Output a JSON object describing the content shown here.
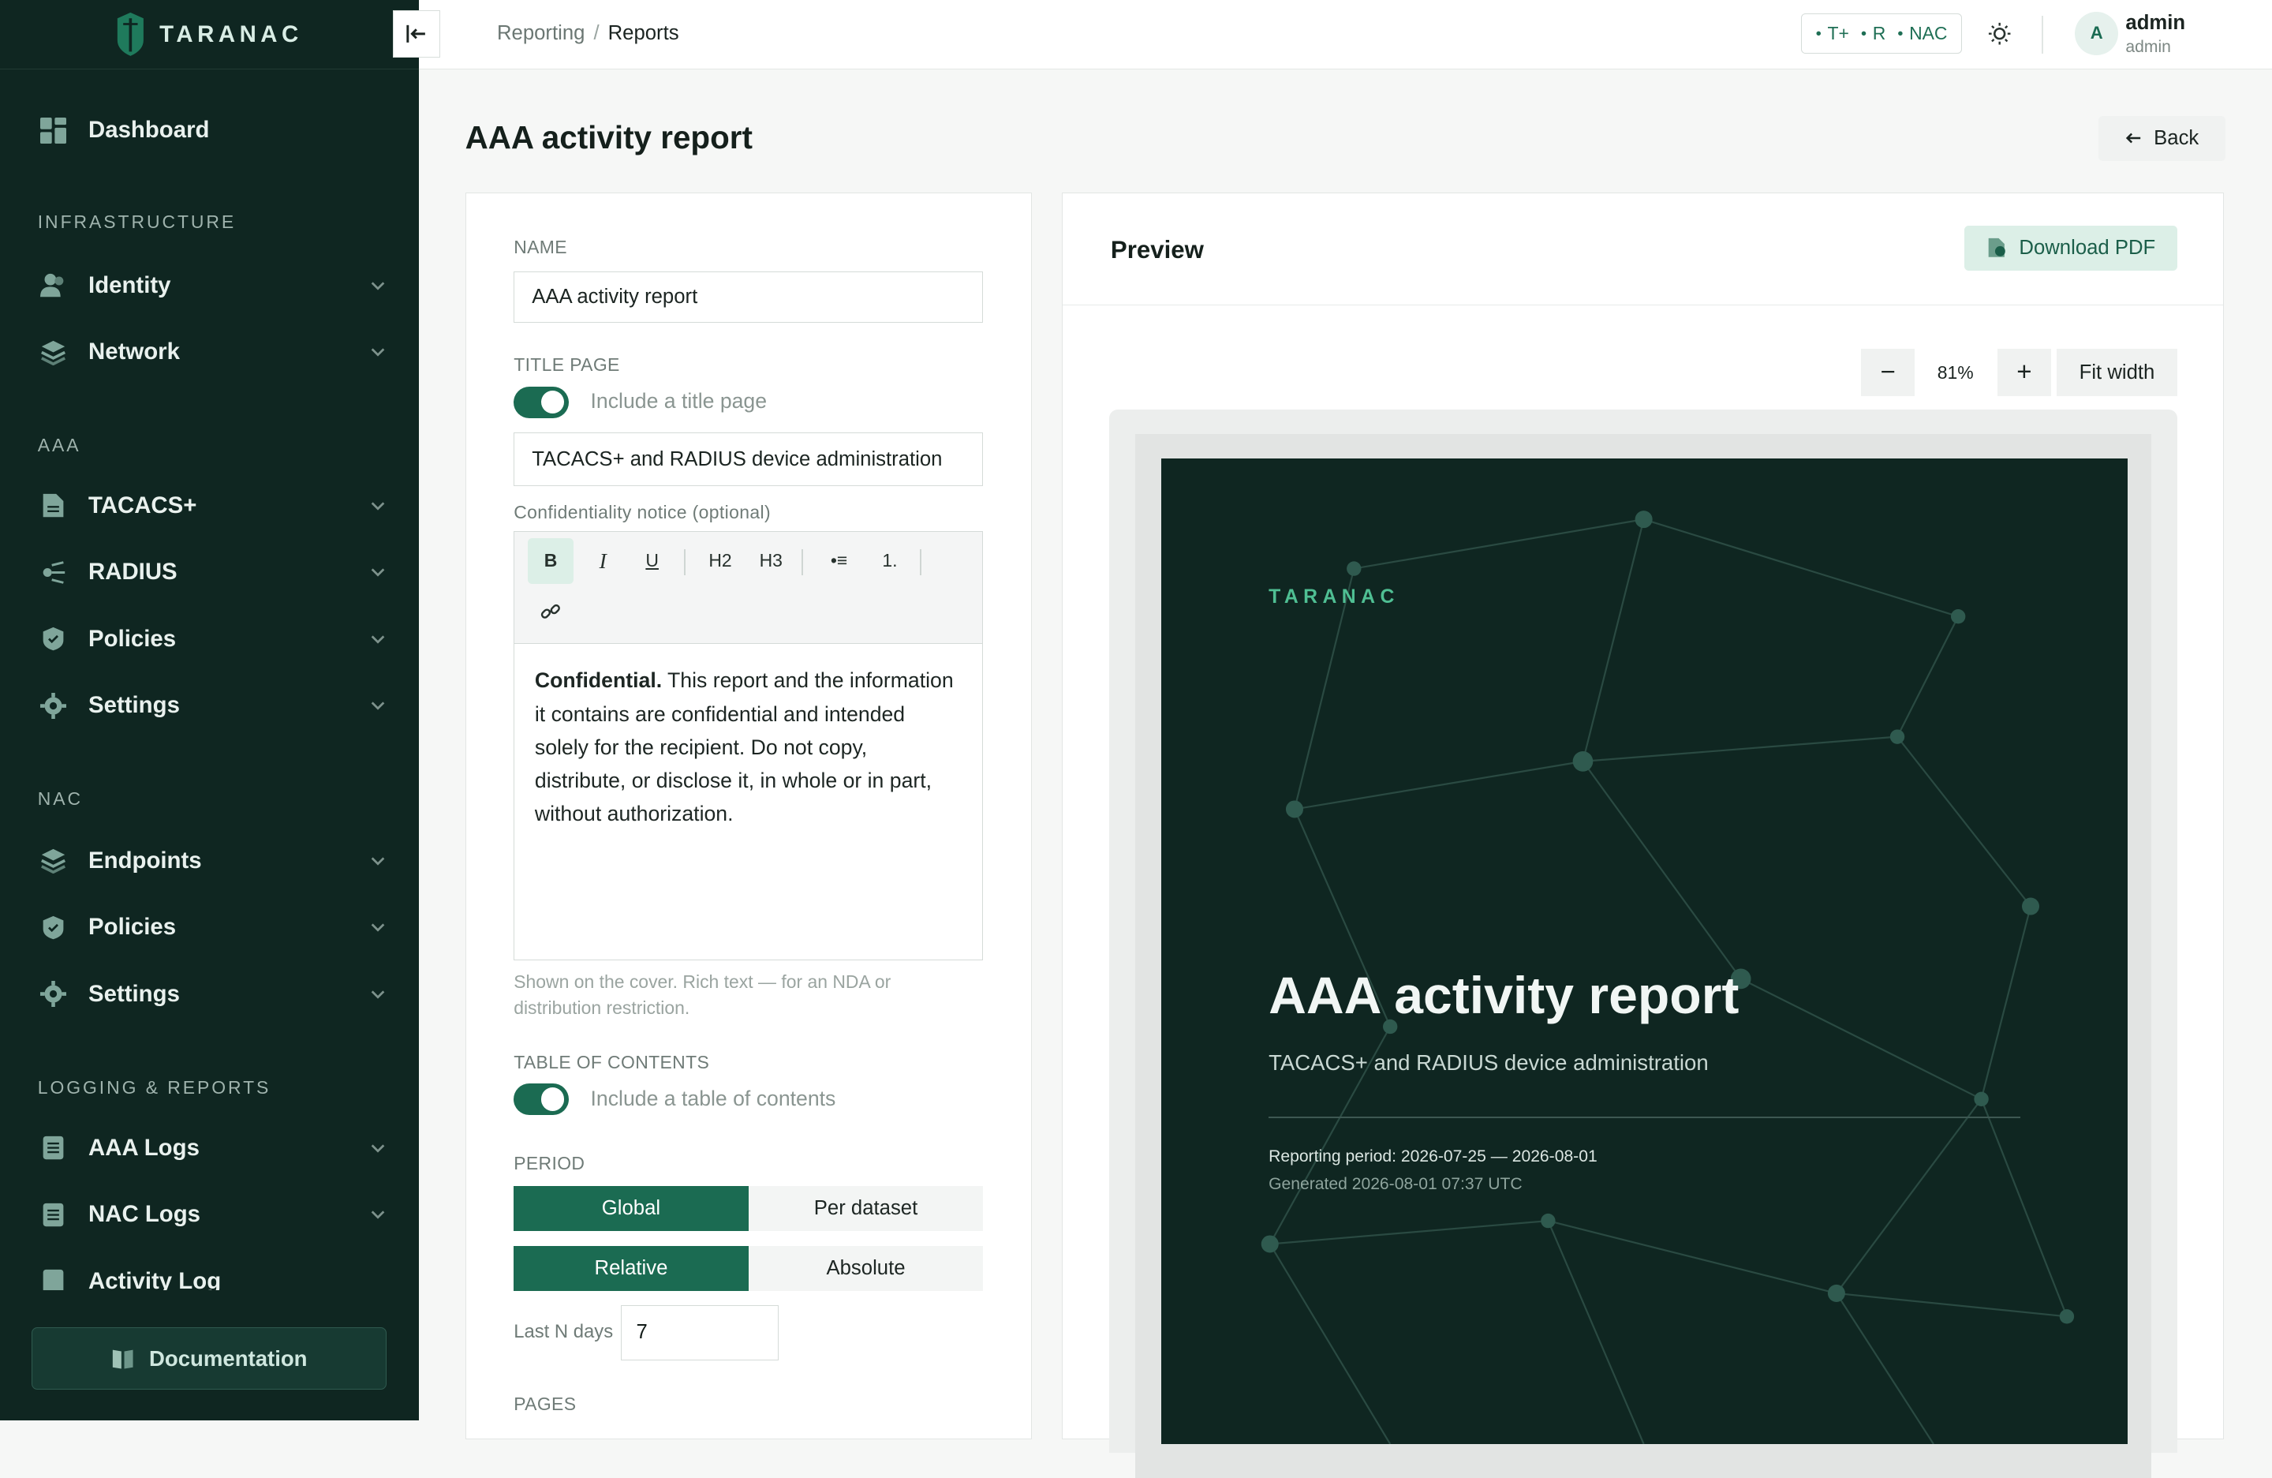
{
  "brand": "TARANAC",
  "sidebar": {
    "dashboard": "Dashboard",
    "sections": {
      "infrastructure": "INFRASTRUCTURE",
      "aaa": "AAA",
      "nac": "NAC",
      "logging": "LOGGING & REPORTS"
    },
    "items": {
      "identity": "Identity",
      "network": "Network",
      "tacacs": "TACACS+",
      "radius": "RADIUS",
      "aaa_policies": "Policies",
      "aaa_settings": "Settings",
      "endpoints": "Endpoints",
      "nac_policies": "Policies",
      "nac_settings": "Settings",
      "aaa_logs": "AAA Logs",
      "nac_logs": "NAC Logs",
      "activity_log": "Activity Log"
    },
    "documentation": "Documentation"
  },
  "topbar": {
    "breadcrumb_parent": "Reporting",
    "breadcrumb_sep": "/",
    "breadcrumb_current": "Reports",
    "protocols": [
      "T+",
      "R",
      "NAC"
    ],
    "avatar_initial": "A",
    "user_name": "admin",
    "user_role": "admin"
  },
  "page": {
    "title": "AAA activity report",
    "back": "Back"
  },
  "form": {
    "name_label": "NAME",
    "name_value": "AAA activity report",
    "title_page_label": "TITLE PAGE",
    "title_page_toggle": "Include a title page",
    "title_page_on": true,
    "subtitle_value": "TACACS+ and RADIUS device administration",
    "confidentiality_label": "Confidentiality notice (optional)",
    "toolbar": [
      "B",
      "I",
      "U",
      "H2",
      "H3",
      "•≡",
      "1."
    ],
    "notice_bold": "Confidential.",
    "notice_text": " This report and the information it contains are confidential and intended solely for the recipient. Do not copy, distribute, or disclose it, in whole or in part, without authorization.",
    "notice_hint": "Shown on the cover. Rich text — for an NDA or distribution restriction.",
    "toc_label": "TABLE OF CONTENTS",
    "toc_toggle": "Include a table of contents",
    "toc_on": true,
    "period_label": "PERIOD",
    "period_scope": [
      "Global",
      "Per dataset"
    ],
    "period_scope_selected": "Global",
    "period_mode": [
      "Relative",
      "Absolute"
    ],
    "period_mode_selected": "Relative",
    "last_n_label": "Last N days",
    "last_n_value": "7",
    "pages_label": "PAGES"
  },
  "preview": {
    "title": "Preview",
    "download": "Download PDF",
    "zoom_minus": "−",
    "zoom": "81%",
    "zoom_plus": "+",
    "fit": "Fit width",
    "cover": {
      "brand": "TARANAC",
      "title": "AAA activity report",
      "subtitle": "TACACS+ and RADIUS device administration",
      "period": "Reporting period: 2026-07-25 — 2026-08-01",
      "generated": "Generated 2026-08-01 07:37 UTC"
    }
  },
  "colors": {
    "sidebar_bg": "#0f2621",
    "accent": "#1b6b52",
    "accent_light": "#dcefe7",
    "cover_bg": "#0f2621"
  }
}
